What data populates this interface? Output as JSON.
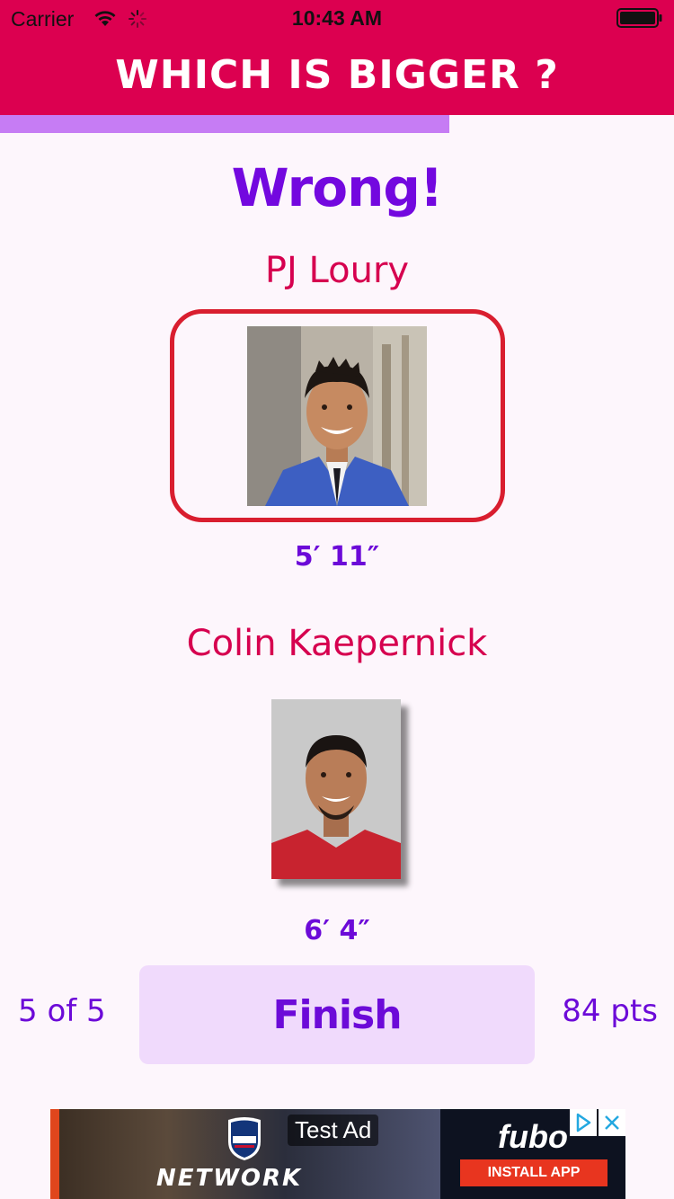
{
  "status_bar": {
    "carrier": "Carrier",
    "time": "10:43 AM"
  },
  "header": {
    "title": "WHICH IS BIGGER ?",
    "background_color": "#dc0050"
  },
  "progress": {
    "fill_fraction": 0.667,
    "color": "#c67cf4"
  },
  "result": {
    "text": "Wrong!"
  },
  "people": [
    {
      "name": "PJ Loury",
      "height": "5′ 11″",
      "selected": true
    },
    {
      "name": "Colin Kaepernick",
      "height": "6′ 4″",
      "selected": false
    }
  ],
  "footer": {
    "counter": "5 of 5",
    "finish_label": "Finish",
    "points": "84 pts"
  },
  "ad": {
    "label": "Test Ad",
    "left_text": "NETWORK",
    "brand": "fubo",
    "cta": "INSTALL APP"
  },
  "colors": {
    "accent_purple": "#6c0ad8",
    "name_red": "#d6004f",
    "frame_red": "#d91e2f",
    "button_bg": "#f0dafc"
  },
  "icons": [
    "wifi-icon",
    "spinner-icon",
    "battery-icon",
    "adchoices-icon",
    "close-icon"
  ]
}
